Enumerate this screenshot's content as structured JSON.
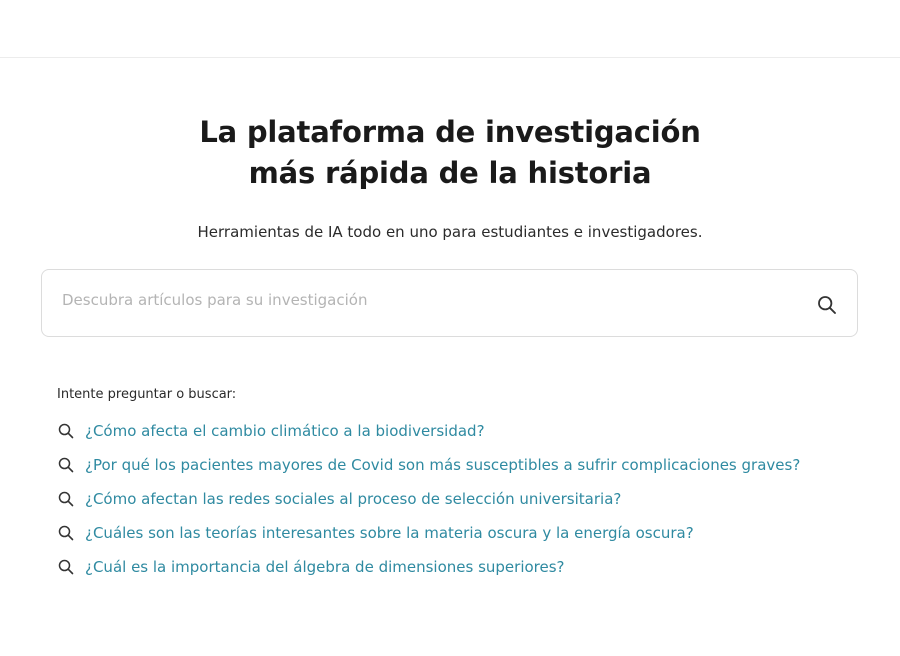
{
  "hero": {
    "title_line1": "La plataforma de investigación",
    "title_line2": "más rápida de la historia",
    "subtitle": "Herramientas de IA todo en uno para estudiantes e investigadores."
  },
  "search": {
    "placeholder": "Descubra artículos para su investigación",
    "value": "",
    "icon": "search-icon"
  },
  "suggestions": {
    "label": "Intente preguntar o buscar:",
    "items": [
      {
        "text": "¿Cómo afecta el cambio climático a la biodiversidad?",
        "icon": "search-icon"
      },
      {
        "text": "¿Por qué los pacientes mayores de Covid son más susceptibles a sufrir complicaciones graves?",
        "icon": "search-icon"
      },
      {
        "text": "¿Cómo afectan las redes sociales al proceso de selección universitaria?",
        "icon": "search-icon"
      },
      {
        "text": "¿Cuáles son las teorías interesantes sobre la materia oscura y la energía oscura?",
        "icon": "search-icon"
      },
      {
        "text": "¿Cuál es la importancia del álgebra de dimensiones superiores?",
        "icon": "search-icon"
      }
    ]
  },
  "colors": {
    "link": "#2f8aa1",
    "border": "#dcdcdc",
    "title": "#1a1a1a"
  }
}
